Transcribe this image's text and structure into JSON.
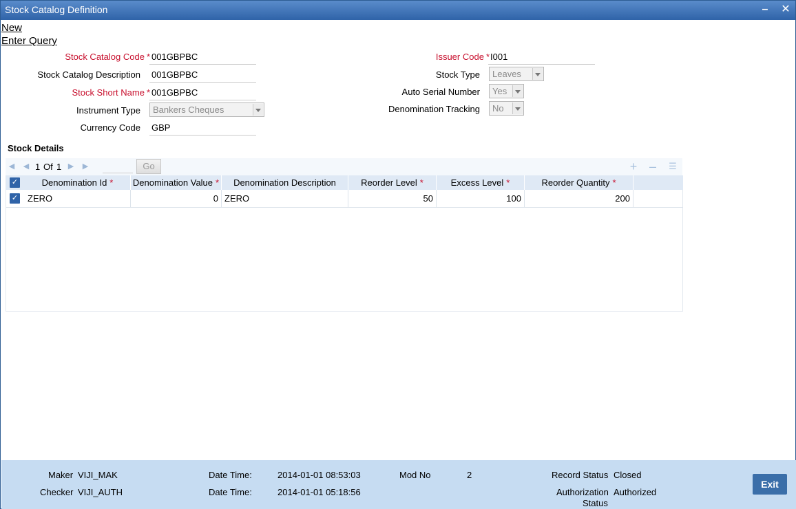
{
  "window": {
    "title": "Stock Catalog Definition",
    "minimize_glyph": "–",
    "close_glyph": "✕"
  },
  "menu": {
    "new": "New",
    "enter_query": "Enter Query"
  },
  "form": {
    "stock_catalog_code": {
      "label": "Stock Catalog Code",
      "value": "001GBPBC",
      "required": "*"
    },
    "stock_catalog_description": {
      "label": "Stock Catalog Description",
      "value": "001GBPBC"
    },
    "stock_short_name": {
      "label": "Stock Short Name",
      "value": "001GBPBC",
      "required": "*"
    },
    "instrument_type": {
      "label": "Instrument Type",
      "value": "Bankers Cheques"
    },
    "currency_code": {
      "label": "Currency Code",
      "value": "GBP"
    },
    "issuer_code": {
      "label": "Issuer Code",
      "value": "I001",
      "required": "*"
    },
    "stock_type": {
      "label": "Stock Type",
      "value": "Leaves"
    },
    "auto_serial_number": {
      "label": "Auto Serial Number",
      "value": "Yes"
    },
    "denomination_tracking": {
      "label": "Denomination Tracking",
      "value": "No"
    }
  },
  "stock_details": {
    "title": "Stock Details",
    "pager": {
      "current": "1",
      "of_label": "Of",
      "total": "1",
      "go_label": "Go"
    },
    "columns": [
      {
        "label": "Denomination Id",
        "required": "*"
      },
      {
        "label": "Denomination Value",
        "required": "*"
      },
      {
        "label": "Denomination Description",
        "required": ""
      },
      {
        "label": "Reorder Level",
        "required": "*"
      },
      {
        "label": "Excess Level",
        "required": "*"
      },
      {
        "label": "Reorder Quantity",
        "required": "*"
      }
    ],
    "rows": [
      {
        "denomination_id": "ZERO",
        "denomination_value": "0",
        "denomination_description": "ZERO",
        "reorder_level": "50",
        "excess_level": "100",
        "reorder_quantity": "200"
      }
    ]
  },
  "footer": {
    "maker_label": "Maker",
    "maker": "VIJI_MAK",
    "checker_label": "Checker",
    "checker": "VIJI_AUTH",
    "datetime_label": "Date Time:",
    "maker_datetime": "2014-01-01 08:53:03",
    "checker_datetime": "2014-01-01 05:18:56",
    "mod_no_label": "Mod No",
    "mod_no": "2",
    "record_status_label": "Record Status",
    "record_status": "Closed",
    "authorization_status_label_1": "Authorization",
    "authorization_status_label_2": "Status",
    "authorization_status": "Authorized",
    "exit_label": "Exit"
  },
  "colors": {
    "title_bar": "#2f63a8",
    "required": "#c8102e",
    "footer_bg": "#c6dcf2",
    "grid_header": "#dfe9f5",
    "exit_button": "#3a6ea9"
  }
}
